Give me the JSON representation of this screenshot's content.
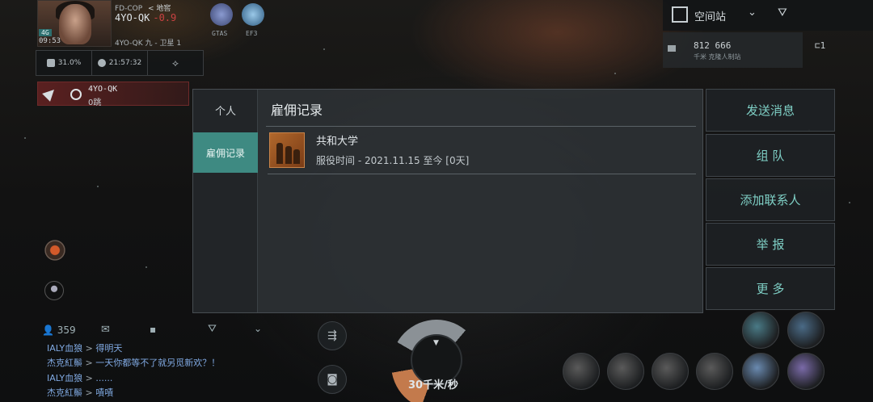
{
  "hud": {
    "region": "FD-COP",
    "back_label": "< 地窖",
    "system": "4YO-QK",
    "security": "-0.9",
    "network": "4G",
    "time": "09:53",
    "location": "4YO-QK 九 - 卫星 1",
    "corp_icons": [
      {
        "label": "GTAS",
        "color": "#6f7fb0"
      },
      {
        "label": "EF3",
        "color": "#4a86b8"
      }
    ],
    "stats": [
      {
        "icon": "cargo-icon",
        "value": "31.0%"
      },
      {
        "icon": "planet-icon",
        "value": "21:57:32"
      },
      {
        "icon": "ship-class-icon",
        "value": ""
      }
    ],
    "target": {
      "name": "4YO-QK",
      "distance": "0跳"
    }
  },
  "overview": {
    "title": "空间站",
    "row_primary": "812 666",
    "row_secondary": "千米  克隆人制站",
    "side_count": "1"
  },
  "chat": {
    "count": "359",
    "lines": [
      {
        "name": "IALY血狼",
        "msg": "得明天"
      },
      {
        "name": "杰克紅鬃",
        "msg": "一天你都等不了就另觅新欢？！"
      },
      {
        "name": "IALY血狼",
        "msg": "......"
      },
      {
        "name": "杰克紅鬃",
        "msg": "嘖嘖"
      }
    ]
  },
  "speed": "30千米/秒",
  "dialog": {
    "tabs": [
      "个人",
      "雇佣记录"
    ],
    "active_tab": 1,
    "title": "雇佣记录",
    "records": [
      {
        "corp": "共和大学",
        "service": "服役时间 - 2021.11.15 至今 [0天]"
      }
    ]
  },
  "actions": [
    "发送消息",
    "组 队",
    "添加联系人",
    "举 报",
    "更 多"
  ]
}
